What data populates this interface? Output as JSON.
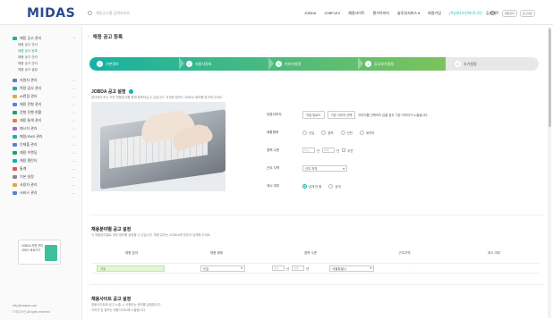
{
  "header": {
    "logo": "MIDAS",
    "search_placeholder": "채용공고를 검색하세요",
    "nav": [
      "JOBDA",
      "JOBFLEX",
      "채용사이트",
      "평가이미지",
      "솔루션서비스 ▾",
      "회원가입",
      "공지사항"
    ],
    "nav_highlight": "(주)미다스인에 로그인",
    "user_name": "김스마트",
    "btn_manage": "계정관리",
    "btn_logout": "로그아웃"
  },
  "sidebar": {
    "groups": [
      {
        "label": "채용 공고 관리",
        "expanded": true,
        "icon_color": "#17b2a3"
      },
      {
        "label": "지원자 관리",
        "icon_color": "#5b7fd6"
      },
      {
        "label": "역량 검사 관리",
        "icon_color": "#17b2a3"
      },
      {
        "label": "AI면접 관리",
        "icon_color": "#e2a83b"
      },
      {
        "label": "채용 전형 관리",
        "icon_color": "#5b7fd6"
      },
      {
        "label": "전형 진행 현황",
        "icon_color": "#1e9e6a"
      },
      {
        "label": "채용 통계 관리",
        "icon_color": "#e97d3f"
      },
      {
        "label": "메시지 관리",
        "icon_color": "#9a6cd6"
      },
      {
        "label": "메일/SMS 관리",
        "icon_color": "#17b2a3"
      },
      {
        "label": "인재풀 관리",
        "icon_color": "#5b7fd6"
      },
      {
        "label": "채용 브랜딩",
        "icon_color": "#1e9e6a"
      },
      {
        "label": "채용 캘린더",
        "icon_color": "#17b2a3"
      },
      {
        "label": "통계",
        "icon_color": "#e05555"
      },
      {
        "label": "기본 설정",
        "icon_color": "#888888"
      },
      {
        "label": "사용자 관리",
        "icon_color": "#e2a83b"
      },
      {
        "label": "서비스 관리",
        "icon_color": "#5b7fd6"
      }
    ],
    "sub_items": [
      "채용 공고 관리",
      "채용 공고 등록",
      "채용 공고 관리",
      "채용 공고 관리",
      "채용 공고 설정"
    ],
    "active_sub": 1,
    "promo_text": "JOBDA 지원 관리 서비스 바로가기",
    "footer_email": "help@midasin.com",
    "footer_copy": "© 미다스인 All rights reserved."
  },
  "page": {
    "title": "채용 공고 등록",
    "steps": [
      {
        "num": "1",
        "label": "기본정보",
        "done": true
      },
      {
        "num": "2",
        "label": "지원서정보",
        "done": true
      },
      {
        "num": "3",
        "label": "커리어설정",
        "done": true
      },
      {
        "num": "4",
        "label": "공고보기설정",
        "done": true
      },
      {
        "num": "5",
        "label": "추가설정",
        "done": false
      }
    ],
    "jobda": {
      "title": "JOBDA 공고 설정",
      "desc": "잡다에서 하는 모든 채용공고를 함께 등록하실 수 있습니다. 자세한 정보는 JOBDA 정보를 참고해 주세요.",
      "fields": {
        "image_label": "대표이미지",
        "image_btn1": "직접 업로드",
        "image_btn2": "기본 이미지 선택",
        "image_hint": "이미지를 선택하지 않을 경우 기본 이미지가 노출됩니다.",
        "employ_label": "채용형태",
        "employ_options": [
          "신입",
          "경력",
          "인턴",
          "계약직"
        ],
        "career_label": "경력 수준",
        "career_from": "최소",
        "career_to": "최대",
        "career_unit": "년",
        "career_any": "무관",
        "location_label": "근무 지역",
        "location_value": "근무 지역",
        "public_label": "게시 여부",
        "public_options": [
          "공개 안 함",
          "공개"
        ]
      }
    },
    "recruit_table": {
      "title": "채용분야별 공고 설정",
      "desc": "각 채용분야별로 세부 정보를 설정할 수 있습니다. 채용 분야는 JOBDA에 맞추어 입력해 주세요.",
      "headers": [
        "채용 분야",
        "채용 형태",
        "경력 수준",
        "근무지역",
        "게시 여부"
      ],
      "row": {
        "field": "개발",
        "type": "신입",
        "from": "최소",
        "to": "최대",
        "unit": "년",
        "region": "서울특별시",
        "public": "-"
      }
    },
    "site": {
      "title": "채용사이트 공고 설정",
      "desc1": "채용사이트에 공고 노출 시 사용되는 정보를 설정합니다.",
      "desc2": "이미지 및 정보는 채용사이트에 노출됩니다."
    }
  }
}
